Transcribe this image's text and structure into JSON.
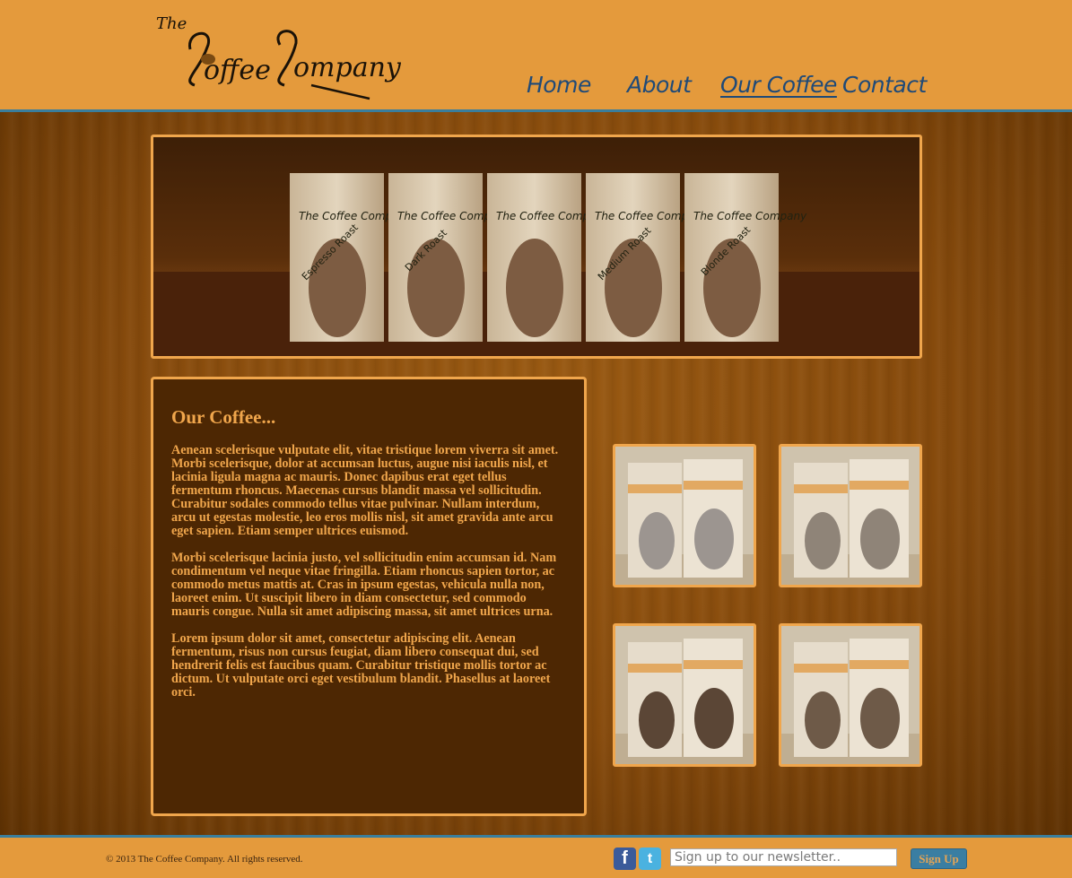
{
  "header": {
    "logo": {
      "small": "The",
      "main": "Coffee Company"
    },
    "nav": [
      {
        "label": "Home"
      },
      {
        "label": "About"
      },
      {
        "label": "Our Coffee",
        "active": true
      },
      {
        "label": "Contact"
      }
    ]
  },
  "hero": {
    "bags": [
      "Espresso Roast",
      "Dark Roast",
      "",
      "Medium Roast",
      "Blonde Roast"
    ]
  },
  "main": {
    "title": "Our Coffee...",
    "paragraphs": [
      "Aenean scelerisque vulputate elit, vitae tristique lorem viverra sit amet. Morbi scelerisque, dolor at accumsan luctus, augue nisi iaculis nisl, et lacinia ligula magna ac mauris. Donec dapibus erat eget tellus fermentum rhoncus. Maecenas cursus blandit massa vel sollicitudin. Curabitur sodales commodo tellus vitae pulvinar. Nullam interdum, arcu ut egestas molestie, leo eros mollis nisl, sit amet gravida ante arcu eget sapien. Etiam semper ultrices euismod.",
      "Morbi scelerisque lacinia justo, vel sollicitudin enim accumsan id. Nam condimentum vel neque vitae fringilla. Etiam rhoncus sapien tortor, ac commodo metus mattis at. Cras in ipsum egestas, vehicula nulla non, laoreet enim. Ut suscipit libero in diam consectetur, sed commodo mauris congue. Nulla sit amet adipiscing massa, sit amet ultrices urna.",
      "Lorem ipsum dolor sit amet, consectetur adipiscing elit. Aenean fermentum, risus non cursus feugiat, diam libero consequat dui, sed hendrerit felis est faucibus quam. Curabitur tristique mollis tortor ac dictum. Ut vulputate orci eget vestibulum blandit. Phasellus at laoreet orci."
    ]
  },
  "footer": {
    "copyright": "© 2013 The Coffee Company. All rights reserved.",
    "newsletter_placeholder": "Sign up to our newsletter..",
    "signup_label": "Sign Up",
    "social": [
      {
        "icon": "facebook-icon",
        "glyph": "f"
      },
      {
        "icon": "twitter-icon",
        "glyph": "t"
      }
    ]
  },
  "colors": {
    "header_bg": "#e49a3c",
    "accent_border": "#f0a64c",
    "divider_blue": "#3a7e9c",
    "panel_bg": "#4d2703",
    "nav_text": "#1f4a78"
  }
}
